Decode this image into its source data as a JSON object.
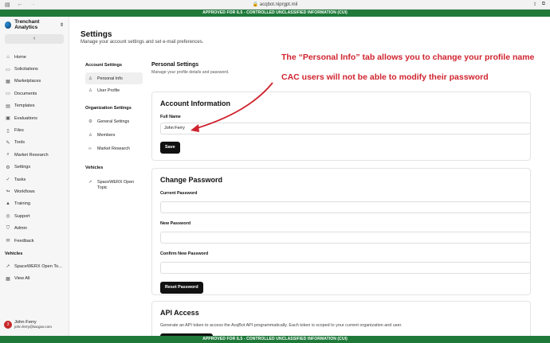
{
  "browser": {
    "url": "acqbot.niprgpt.mil"
  },
  "banner_text": "APPROVED FOR IL5 - CONTROLLED UNCLASSIFIED INFORMATION (CUI)",
  "sidebar": {
    "org_name": "Trenchant Analytics",
    "items": [
      {
        "label": "Home",
        "icon": "home-icon"
      },
      {
        "label": "Solicitations",
        "icon": "document-icon"
      },
      {
        "label": "Marketplaces",
        "icon": "store-icon"
      },
      {
        "label": "Documents",
        "icon": "document-icon"
      },
      {
        "label": "Templates",
        "icon": "template-icon"
      },
      {
        "label": "Evaluations",
        "icon": "clipboard-icon"
      },
      {
        "label": "Files",
        "icon": "file-icon"
      },
      {
        "label": "Tools",
        "icon": "wrench-icon"
      },
      {
        "label": "Market Research",
        "icon": "search-icon"
      },
      {
        "label": "Settings",
        "icon": "gear-icon"
      },
      {
        "label": "Tasks",
        "icon": "check-icon"
      },
      {
        "label": "Workflows",
        "icon": "workflow-icon"
      },
      {
        "label": "Training",
        "icon": "graduation-icon"
      },
      {
        "label": "Support",
        "icon": "help-icon"
      },
      {
        "label": "Admin",
        "icon": "shield-icon"
      },
      {
        "label": "Feedback",
        "icon": "feedback-icon"
      }
    ],
    "vehicles_label": "Vehicles",
    "vehicle_items": [
      {
        "label": "SpaceWERX Open To...",
        "icon": "rocket-icon"
      },
      {
        "label": "View All",
        "icon": "grid-icon"
      }
    ],
    "user": {
      "name": "John Ferry",
      "email": "john.ferry@tacgov.com",
      "badge": "3"
    }
  },
  "page": {
    "title": "Settings",
    "subtitle": "Manage your account settings and set e-mail preferences."
  },
  "settings_nav": {
    "account_head": "Account Settings",
    "account_items": [
      {
        "label": "Personal Info",
        "icon": "user-icon",
        "active": true
      },
      {
        "label": "User Profile",
        "icon": "user-icon",
        "active": false
      }
    ],
    "org_head": "Organization Settings",
    "org_items": [
      {
        "label": "General Settings",
        "icon": "gear-icon"
      },
      {
        "label": "Members",
        "icon": "users-icon"
      },
      {
        "label": "Market Research",
        "icon": "link-icon"
      }
    ],
    "vehicles_head": "Vehicles",
    "vehicle_items": [
      {
        "label": "SpaceWERX Open Topic",
        "icon": "rocket-icon"
      }
    ]
  },
  "personal_settings": {
    "title": "Personal Settings",
    "subtitle": "Manage your profile details and password."
  },
  "account_info": {
    "title": "Account Information",
    "full_name_label": "Full Name",
    "full_name_value": "John Ferry",
    "save_label": "Save"
  },
  "change_password": {
    "title": "Change Password",
    "current_label": "Current Password",
    "new_label": "New Password",
    "confirm_label": "Confirm New Password",
    "button_label": "Reset Password"
  },
  "api_access": {
    "title": "API Access",
    "description": "Generate an API token to access the AcqBot API programmatically. Each token is scoped to your current organization and user."
  },
  "annotations": {
    "line1": "The “Personal Info” tab allows you to change your profile name",
    "line2": "CAC users will not be able to modify their password",
    "color": "#d0232e"
  }
}
